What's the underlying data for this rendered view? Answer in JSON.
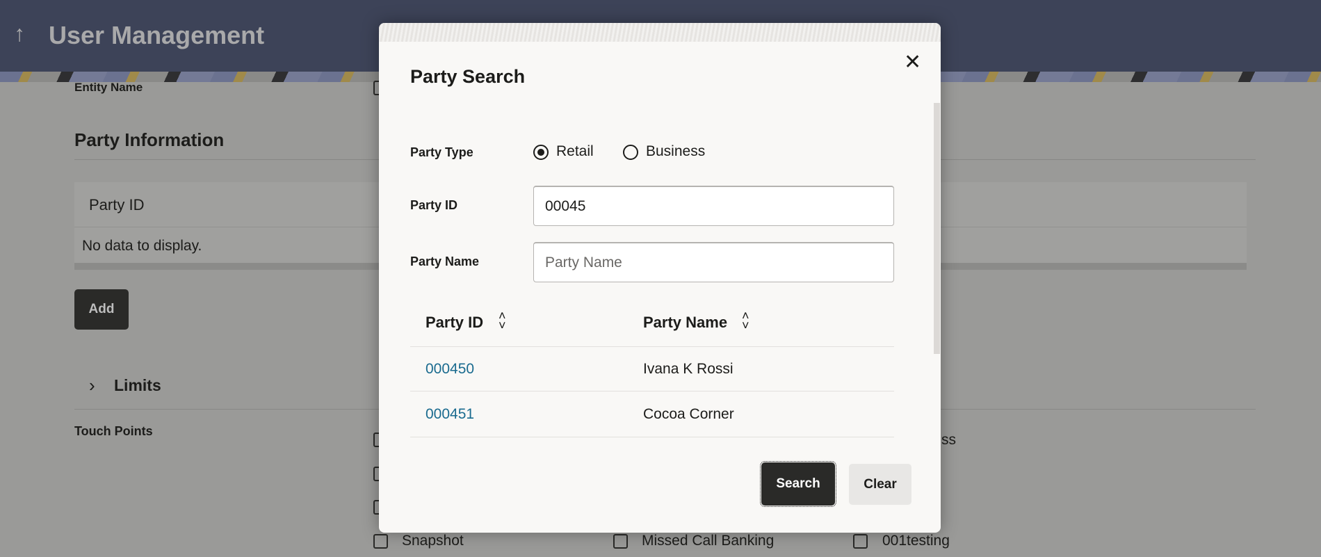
{
  "header": {
    "title": "User Management",
    "back_icon": "arrow-up-icon"
  },
  "page": {
    "entity_name_label": "Entity Name",
    "party_information_heading": "Party Information",
    "party_table": {
      "column": "Party ID",
      "empty_text": "No data to display."
    },
    "add_label": "Add",
    "limits_label": "Limits",
    "touch_points_label": "Touch Points",
    "touch_points": [
      {
        "label": "ss",
        "checked": false
      },
      {
        "label": "Snapshot",
        "checked": false
      },
      {
        "label": "Missed Call Banking",
        "checked": false
      },
      {
        "label": "001testing",
        "checked": false
      }
    ]
  },
  "modal": {
    "title": "Party Search",
    "party_type_label": "Party Type",
    "party_type_options": [
      {
        "label": "Retail",
        "selected": true
      },
      {
        "label": "Business",
        "selected": false
      }
    ],
    "party_id_label": "Party ID",
    "party_id_value": "00045",
    "party_name_label": "Party Name",
    "party_name_placeholder": "Party Name",
    "columns": [
      "Party ID",
      "Party Name"
    ],
    "rows": [
      {
        "id": "000450",
        "name": "Ivana K Rossi"
      },
      {
        "id": "000451",
        "name": "Cocoa Corner"
      }
    ],
    "search_label": "Search",
    "clear_label": "Clear"
  },
  "colors": {
    "header": "#3d4358",
    "link": "#1a6b8f",
    "primary_button": "#2a2a28",
    "secondary_button": "#e8e7e5"
  }
}
